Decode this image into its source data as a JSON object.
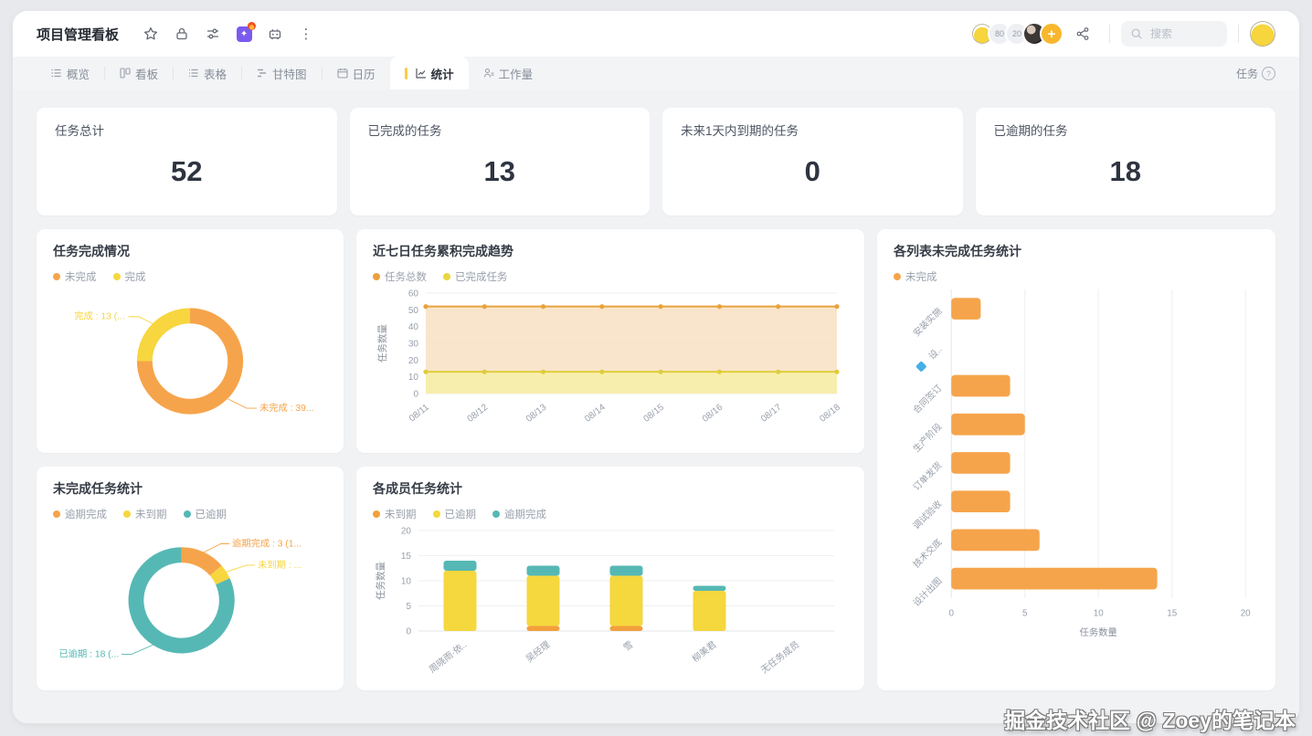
{
  "app": {
    "title": "项目管理看板",
    "toolbar_icons": [
      "star-icon",
      "lock-icon",
      "sliders-icon",
      "magic-icon",
      "robot-icon",
      "more-icon"
    ],
    "topbar": {
      "avatars": [
        {
          "type": "emoji",
          "label": ""
        },
        {
          "type": "text",
          "label": "80"
        },
        {
          "type": "text",
          "label": "20"
        },
        {
          "type": "photo",
          "label": ""
        }
      ],
      "add_member": "+",
      "search_placeholder": "搜索",
      "task_menu": "任务"
    },
    "tabs": [
      {
        "key": "overview",
        "label": "概览",
        "active": false
      },
      {
        "key": "kanban",
        "label": "看板",
        "active": false
      },
      {
        "key": "table",
        "label": "表格",
        "active": false
      },
      {
        "key": "gantt",
        "label": "甘特图",
        "active": false
      },
      {
        "key": "calendar",
        "label": "日历",
        "active": false
      },
      {
        "key": "stats",
        "label": "统计",
        "active": true
      },
      {
        "key": "workload",
        "label": "工作量",
        "active": false
      }
    ],
    "stat_cards": [
      {
        "title": "任务总计",
        "value": "52"
      },
      {
        "title": "已完成的任务",
        "value": "13"
      },
      {
        "title": "未来1天内到期的任务",
        "value": "0"
      },
      {
        "title": "已逾期的任务",
        "value": "18"
      }
    ],
    "watermark": "掘金技术社区 @ Zoey的笔记本"
  },
  "colors": {
    "orange": "#F6A44B",
    "yellow": "#F7D63F",
    "teal": "#56B8B4",
    "area_orange": "#F8E2C5",
    "area_yellow": "#F7EDA9"
  },
  "chart_data": [
    {
      "id": "completion_donut",
      "type": "pie",
      "title": "任务完成情况",
      "legend": [
        {
          "label": "未完成",
          "color": "#F6A44B"
        },
        {
          "label": "完成",
          "color": "#F7D63F"
        }
      ],
      "slices": [
        {
          "name": "未完成",
          "value": 39,
          "color": "#F6A44B",
          "label": "未完成 : 39..."
        },
        {
          "name": "完成",
          "value": 13,
          "color": "#F7D63F",
          "label": "完成 : 13 (..."
        }
      ]
    },
    {
      "id": "trend_area",
      "type": "area",
      "title": "近七日任务累积完成趋势",
      "legend": [
        {
          "label": "任务总数",
          "color": "#EE9F3C"
        },
        {
          "label": "已完成任务",
          "color": "#EBD53E"
        }
      ],
      "x": [
        "08/11",
        "08/12",
        "08/13",
        "08/14",
        "08/15",
        "08/16",
        "08/17",
        "08/18"
      ],
      "series": [
        {
          "name": "任务总数",
          "values": [
            52,
            52,
            52,
            52,
            52,
            52,
            52,
            52
          ],
          "line": "#E8A33C",
          "fill": "#F8E2C5"
        },
        {
          "name": "已完成任务",
          "values": [
            13,
            13,
            13,
            13,
            13,
            13,
            13,
            13
          ],
          "line": "#E0CC3B",
          "fill": "#F7EDA9"
        }
      ],
      "ylabel": "任务数量",
      "ylim": [
        0,
        60
      ],
      "yticks": [
        0,
        10,
        20,
        30,
        40,
        50,
        60
      ]
    },
    {
      "id": "list_bars",
      "type": "bar-horizontal",
      "title": "各列表未完成任务统计",
      "legend": [
        {
          "label": "未完成",
          "color": "#F6A44B"
        }
      ],
      "categories": [
        {
          "label": "安装实施"
        },
        {
          "label": "设..",
          "icon": "blue-doc-icon"
        },
        {
          "label": "合同签订"
        },
        {
          "label": "生产阶段"
        },
        {
          "label": "订单发货"
        },
        {
          "label": "调试验收"
        },
        {
          "label": "技术交底"
        },
        {
          "label": "设计出图"
        }
      ],
      "values": [
        2,
        0,
        4,
        5,
        4,
        4,
        6,
        14
      ],
      "bar_color": "#F6A44B",
      "xlabel": "任务数量",
      "xlim": [
        0,
        20
      ],
      "xticks": [
        0,
        5,
        10,
        15,
        20
      ]
    },
    {
      "id": "unfinished_donut",
      "type": "pie",
      "title": "未完成任务统计",
      "legend": [
        {
          "label": "逾期完成",
          "color": "#F6A44B"
        },
        {
          "label": "未到期",
          "color": "#F7D63F"
        },
        {
          "label": "已逾期",
          "color": "#56B8B4"
        }
      ],
      "slices": [
        {
          "name": "逾期完成",
          "value": 3,
          "color": "#F6A44B",
          "label": "逾期完成 : 3 (1..."
        },
        {
          "name": "未到期",
          "value": 1,
          "color": "#F7D63F",
          "label": "未到期 : ..."
        },
        {
          "name": "已逾期",
          "value": 18,
          "color": "#56B8B4",
          "label": "已逾期 : 18 (..."
        }
      ]
    },
    {
      "id": "member_bars",
      "type": "bar-stacked",
      "title": "各成员任务统计",
      "legend": [
        {
          "label": "未到期",
          "color": "#F2A03D"
        },
        {
          "label": "已逾期",
          "color": "#F5D73E"
        },
        {
          "label": "逾期完成",
          "color": "#56B8B4"
        }
      ],
      "categories": [
        "周晓雨·依..",
        "吴经理",
        "雪",
        "柳美君",
        "无任务成员"
      ],
      "series": [
        {
          "name": "未到期",
          "values": [
            0,
            1,
            1,
            0,
            0
          ],
          "color": "#F2A03D"
        },
        {
          "name": "已逾期",
          "values": [
            12,
            10,
            10,
            8,
            0
          ],
          "color": "#F5D73E"
        },
        {
          "name": "逾期完成",
          "values": [
            2,
            2,
            2,
            1,
            0
          ],
          "color": "#56B8B4"
        }
      ],
      "ylabel": "任务数量",
      "ylim": [
        0,
        20
      ],
      "yticks": [
        0,
        5,
        10,
        15,
        20
      ]
    }
  ]
}
